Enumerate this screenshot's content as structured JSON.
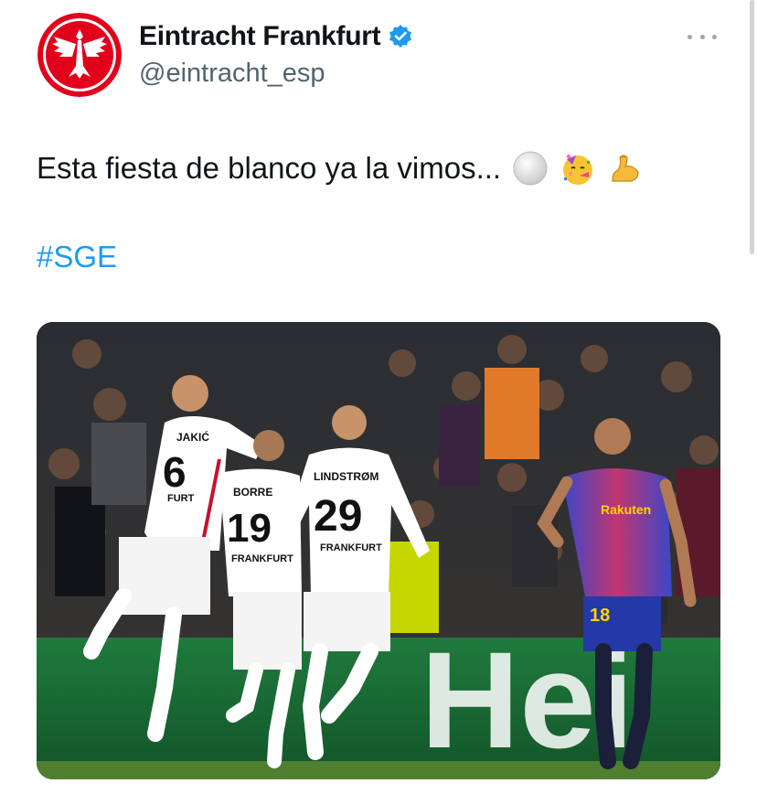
{
  "tweet": {
    "display_name": "Eintracht Frankfurt",
    "handle": "@eintracht_esp",
    "text": "Esta fiesta de blanco ya la vimos...",
    "hashtag": "#SGE",
    "emojis": [
      "white-circle-emoji",
      "party-face-emoji",
      "flexed-biceps-emoji"
    ],
    "verified_color": "#1d9bf0"
  },
  "photo": {
    "players": [
      {
        "name": "JAKIĆ",
        "number": "6",
        "shirt_text": "FURT"
      },
      {
        "name": "BORRE",
        "number": "19",
        "shirt_text": "FRANKFURT"
      },
      {
        "name": "LINDSTRØM",
        "number": "29",
        "shirt_text": "FRANKFURT"
      },
      {
        "name": "",
        "number": "18",
        "shirt_text": "Rakuten"
      }
    ],
    "board_text": "Hei"
  }
}
